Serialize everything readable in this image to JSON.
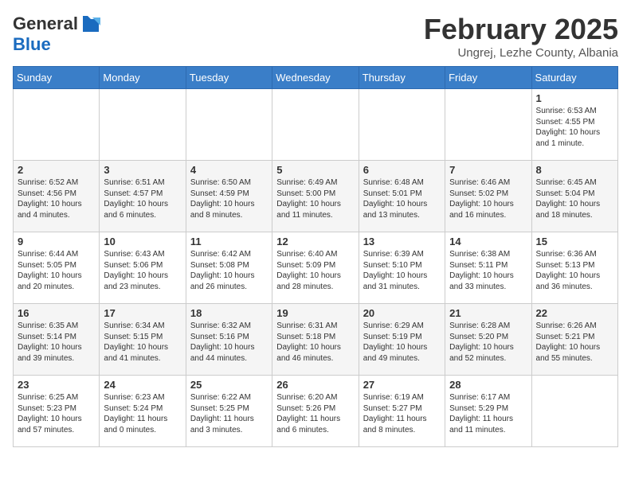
{
  "header": {
    "logo_general": "General",
    "logo_blue": "Blue",
    "month_title": "February 2025",
    "location": "Ungrej, Lezhe County, Albania"
  },
  "weekdays": [
    "Sunday",
    "Monday",
    "Tuesday",
    "Wednesday",
    "Thursday",
    "Friday",
    "Saturday"
  ],
  "weeks": [
    [
      {
        "day": "",
        "info": ""
      },
      {
        "day": "",
        "info": ""
      },
      {
        "day": "",
        "info": ""
      },
      {
        "day": "",
        "info": ""
      },
      {
        "day": "",
        "info": ""
      },
      {
        "day": "",
        "info": ""
      },
      {
        "day": "1",
        "info": "Sunrise: 6:53 AM\nSunset: 4:55 PM\nDaylight: 10 hours and 1 minute."
      }
    ],
    [
      {
        "day": "2",
        "info": "Sunrise: 6:52 AM\nSunset: 4:56 PM\nDaylight: 10 hours and 4 minutes."
      },
      {
        "day": "3",
        "info": "Sunrise: 6:51 AM\nSunset: 4:57 PM\nDaylight: 10 hours and 6 minutes."
      },
      {
        "day": "4",
        "info": "Sunrise: 6:50 AM\nSunset: 4:59 PM\nDaylight: 10 hours and 8 minutes."
      },
      {
        "day": "5",
        "info": "Sunrise: 6:49 AM\nSunset: 5:00 PM\nDaylight: 10 hours and 11 minutes."
      },
      {
        "day": "6",
        "info": "Sunrise: 6:48 AM\nSunset: 5:01 PM\nDaylight: 10 hours and 13 minutes."
      },
      {
        "day": "7",
        "info": "Sunrise: 6:46 AM\nSunset: 5:02 PM\nDaylight: 10 hours and 16 minutes."
      },
      {
        "day": "8",
        "info": "Sunrise: 6:45 AM\nSunset: 5:04 PM\nDaylight: 10 hours and 18 minutes."
      }
    ],
    [
      {
        "day": "9",
        "info": "Sunrise: 6:44 AM\nSunset: 5:05 PM\nDaylight: 10 hours and 20 minutes."
      },
      {
        "day": "10",
        "info": "Sunrise: 6:43 AM\nSunset: 5:06 PM\nDaylight: 10 hours and 23 minutes."
      },
      {
        "day": "11",
        "info": "Sunrise: 6:42 AM\nSunset: 5:08 PM\nDaylight: 10 hours and 26 minutes."
      },
      {
        "day": "12",
        "info": "Sunrise: 6:40 AM\nSunset: 5:09 PM\nDaylight: 10 hours and 28 minutes."
      },
      {
        "day": "13",
        "info": "Sunrise: 6:39 AM\nSunset: 5:10 PM\nDaylight: 10 hours and 31 minutes."
      },
      {
        "day": "14",
        "info": "Sunrise: 6:38 AM\nSunset: 5:11 PM\nDaylight: 10 hours and 33 minutes."
      },
      {
        "day": "15",
        "info": "Sunrise: 6:36 AM\nSunset: 5:13 PM\nDaylight: 10 hours and 36 minutes."
      }
    ],
    [
      {
        "day": "16",
        "info": "Sunrise: 6:35 AM\nSunset: 5:14 PM\nDaylight: 10 hours and 39 minutes."
      },
      {
        "day": "17",
        "info": "Sunrise: 6:34 AM\nSunset: 5:15 PM\nDaylight: 10 hours and 41 minutes."
      },
      {
        "day": "18",
        "info": "Sunrise: 6:32 AM\nSunset: 5:16 PM\nDaylight: 10 hours and 44 minutes."
      },
      {
        "day": "19",
        "info": "Sunrise: 6:31 AM\nSunset: 5:18 PM\nDaylight: 10 hours and 46 minutes."
      },
      {
        "day": "20",
        "info": "Sunrise: 6:29 AM\nSunset: 5:19 PM\nDaylight: 10 hours and 49 minutes."
      },
      {
        "day": "21",
        "info": "Sunrise: 6:28 AM\nSunset: 5:20 PM\nDaylight: 10 hours and 52 minutes."
      },
      {
        "day": "22",
        "info": "Sunrise: 6:26 AM\nSunset: 5:21 PM\nDaylight: 10 hours and 55 minutes."
      }
    ],
    [
      {
        "day": "23",
        "info": "Sunrise: 6:25 AM\nSunset: 5:23 PM\nDaylight: 10 hours and 57 minutes."
      },
      {
        "day": "24",
        "info": "Sunrise: 6:23 AM\nSunset: 5:24 PM\nDaylight: 11 hours and 0 minutes."
      },
      {
        "day": "25",
        "info": "Sunrise: 6:22 AM\nSunset: 5:25 PM\nDaylight: 11 hours and 3 minutes."
      },
      {
        "day": "26",
        "info": "Sunrise: 6:20 AM\nSunset: 5:26 PM\nDaylight: 11 hours and 6 minutes."
      },
      {
        "day": "27",
        "info": "Sunrise: 6:19 AM\nSunset: 5:27 PM\nDaylight: 11 hours and 8 minutes."
      },
      {
        "day": "28",
        "info": "Sunrise: 6:17 AM\nSunset: 5:29 PM\nDaylight: 11 hours and 11 minutes."
      },
      {
        "day": "",
        "info": ""
      }
    ]
  ]
}
